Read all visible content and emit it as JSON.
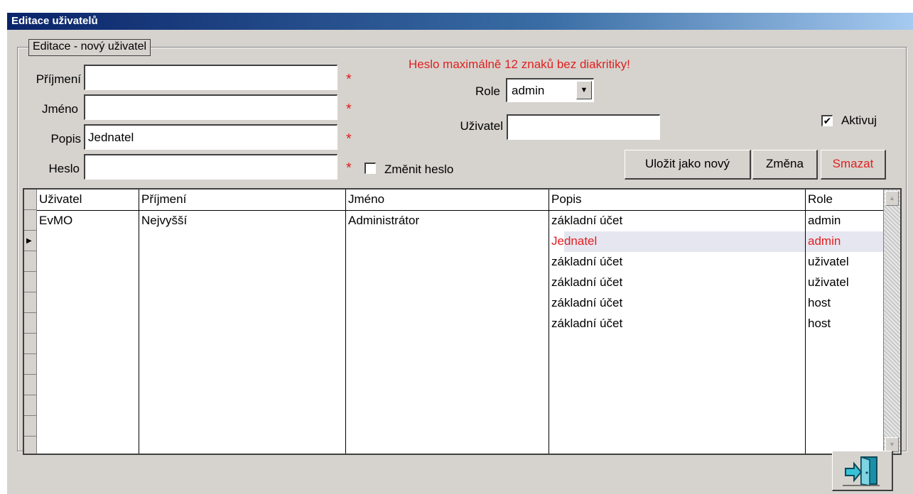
{
  "window": {
    "title": "Editace uživatelů"
  },
  "group": {
    "legend": "Editace - nový uživatel"
  },
  "form": {
    "prijmeni_label": "Příjmení",
    "prijmeni_value": "",
    "jmeno_label": "Jméno",
    "jmeno_value": "",
    "popis_label": "Popis",
    "popis_value": "Jednatel",
    "heslo_label": "Heslo",
    "heslo_value": "",
    "required_mark": "*",
    "zmenit_heslo_label": "Změnit heslo",
    "zmenit_heslo_checked": false,
    "password_warning": "Heslo maximálně 12 znaků bez diakritiky!",
    "role_label": "Role",
    "role_value": "admin",
    "uzivatel_label": "Uživatel",
    "uzivatel_value": "",
    "aktivuj_label": "Aktivuj",
    "aktivuj_checked": true,
    "check_glyph": "✔"
  },
  "buttons": {
    "save_new": "Uložit jako nový",
    "change": "Změna",
    "delete": "Smazat"
  },
  "grid": {
    "columns": [
      "Uživatel",
      "Příjmení",
      "Jméno",
      "Popis",
      "Role"
    ],
    "rows": [
      {
        "uzivatel": "EvMO",
        "prijmeni": "Nejvyšší",
        "jmeno": "Administrátor",
        "popis": "základní účet",
        "role": "admin"
      },
      {
        "uzivatel": "",
        "prijmeni": "",
        "jmeno": "",
        "popis": "Jednatel",
        "role": "admin",
        "current": true
      },
      {
        "uzivatel": "",
        "prijmeni": "",
        "jmeno": "",
        "popis": "základní účet",
        "role": "uživatel"
      },
      {
        "uzivatel": "",
        "prijmeni": "",
        "jmeno": "",
        "popis": "základní účet",
        "role": "uživatel"
      },
      {
        "uzivatel": "",
        "prijmeni": "",
        "jmeno": "",
        "popis": "základní účet",
        "role": "host"
      },
      {
        "uzivatel": "",
        "prijmeni": "",
        "jmeno": "",
        "popis": "základní účet",
        "role": "host"
      }
    ]
  },
  "colors": {
    "title_bar": "#0a246a",
    "warning": "#e02020",
    "window_bg": "#d6d3ce"
  },
  "icons": {
    "exit": "exit-door-icon",
    "dropdown": "chevron-down-icon",
    "row_pointer": "row-pointer-icon"
  }
}
